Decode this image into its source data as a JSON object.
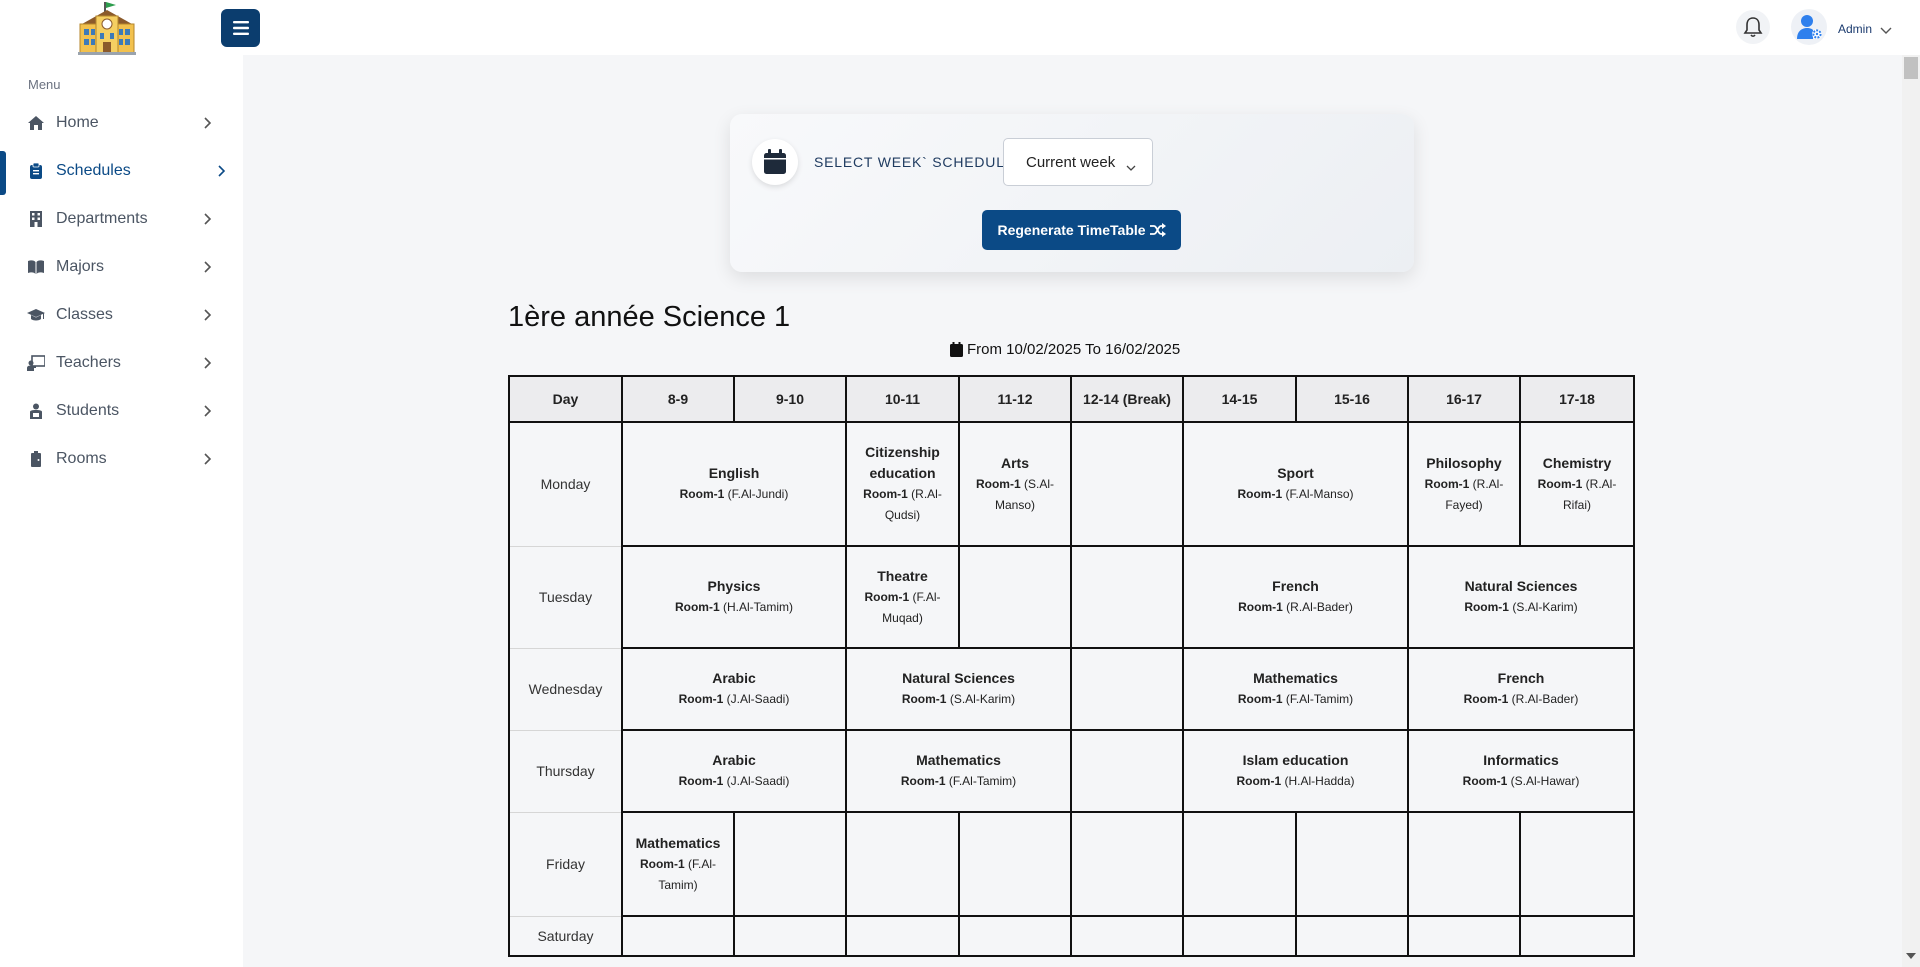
{
  "header": {
    "user_name": "Admin"
  },
  "sidebar": {
    "menu_label": "Menu",
    "items": [
      {
        "label": "Home",
        "icon": "home-icon"
      },
      {
        "label": "Schedules",
        "icon": "clipboard-icon",
        "active": true
      },
      {
        "label": "Departments",
        "icon": "building-icon"
      },
      {
        "label": "Majors",
        "icon": "book-icon"
      },
      {
        "label": "Classes",
        "icon": "graduation-cap-icon"
      },
      {
        "label": "Teachers",
        "icon": "chalkboard-teacher-icon"
      },
      {
        "label": "Students",
        "icon": "students-icon"
      },
      {
        "label": "Rooms",
        "icon": "door-icon"
      }
    ]
  },
  "week_card": {
    "label": "SELECT WEEK` SCHEDULE:",
    "selected_week": "Current week",
    "regenerate_label": "Regenerate TimeTable"
  },
  "schedule": {
    "title": "1ère année Science 1",
    "date_range": "From 10/02/2025 To 16/02/2025",
    "day_header": "Day",
    "slots": [
      "8-9",
      "9-10",
      "10-11",
      "11-12",
      "12-14 (Break)",
      "14-15",
      "15-16",
      "16-17",
      "17-18"
    ],
    "rows": [
      {
        "day": "Monday",
        "cells": [
          {
            "span": 2,
            "subject": "English",
            "room": "Room-1",
            "teacher": "(F.Al-Jundi)"
          },
          {
            "span": 1,
            "subject": "Citizenship education",
            "room": "Room-1",
            "teacher": "(R.Al-Qudsi)"
          },
          {
            "span": 1,
            "subject": "Arts",
            "room": "Room-1",
            "teacher": "(S.Al-Manso)"
          },
          {
            "span": 1
          },
          {
            "span": 2,
            "subject": "Sport",
            "room": "Room-1",
            "teacher": "(F.Al-Manso)"
          },
          {
            "span": 1,
            "subject": "Philosophy",
            "room": "Room-1",
            "teacher": "(R.Al-Fayed)"
          },
          {
            "span": 1,
            "subject": "Chemistry",
            "room": "Room-1",
            "teacher": "(R.Al-Rifai)"
          }
        ]
      },
      {
        "day": "Tuesday",
        "cells": [
          {
            "span": 2,
            "subject": "Physics",
            "room": "Room-1",
            "teacher": "(H.Al-Tamim)"
          },
          {
            "span": 1,
            "subject": "Theatre",
            "room": "Room-1",
            "teacher": "(F.Al-Muqad)"
          },
          {
            "span": 1
          },
          {
            "span": 1
          },
          {
            "span": 2,
            "subject": "French",
            "room": "Room-1",
            "teacher": "(R.Al-Bader)"
          },
          {
            "span": 2,
            "subject": "Natural Sciences",
            "room": "Room-1",
            "teacher": "(S.Al-Karim)"
          }
        ]
      },
      {
        "day": "Wednesday",
        "cells": [
          {
            "span": 2,
            "subject": "Arabic",
            "room": "Room-1",
            "teacher": "(J.Al-Saadi)"
          },
          {
            "span": 2,
            "subject": "Natural Sciences",
            "room": "Room-1",
            "teacher": "(S.Al-Karim)"
          },
          {
            "span": 1
          },
          {
            "span": 2,
            "subject": "Mathematics",
            "room": "Room-1",
            "teacher": "(F.Al-Tamim)"
          },
          {
            "span": 2,
            "subject": "French",
            "room": "Room-1",
            "teacher": "(R.Al-Bader)"
          }
        ]
      },
      {
        "day": "Thursday",
        "cells": [
          {
            "span": 2,
            "subject": "Arabic",
            "room": "Room-1",
            "teacher": "(J.Al-Saadi)"
          },
          {
            "span": 2,
            "subject": "Mathematics",
            "room": "Room-1",
            "teacher": "(F.Al-Tamim)"
          },
          {
            "span": 1
          },
          {
            "span": 2,
            "subject": "Islam education",
            "room": "Room-1",
            "teacher": "(H.Al-Hadda)"
          },
          {
            "span": 2,
            "subject": "Informatics",
            "room": "Room-1",
            "teacher": "(S.Al-Hawar)"
          }
        ]
      },
      {
        "day": "Friday",
        "cells": [
          {
            "span": 1,
            "subject": "Mathematics",
            "room": "Room-1",
            "teacher": "(F.Al-Tamim)"
          },
          {
            "span": 1
          },
          {
            "span": 1
          },
          {
            "span": 1
          },
          {
            "span": 1
          },
          {
            "span": 1
          },
          {
            "span": 1
          },
          {
            "span": 1
          },
          {
            "span": 1
          }
        ]
      },
      {
        "day": "Saturday",
        "cells": [
          {
            "span": 1
          },
          {
            "span": 1
          },
          {
            "span": 1
          },
          {
            "span": 1
          },
          {
            "span": 1
          },
          {
            "span": 1
          },
          {
            "span": 1
          },
          {
            "span": 1
          },
          {
            "span": 1
          }
        ]
      }
    ]
  },
  "colors": {
    "primary": "#0b4a86",
    "sidebar_active": "#0b4a86",
    "page_bg": "#f5f6f8"
  }
}
